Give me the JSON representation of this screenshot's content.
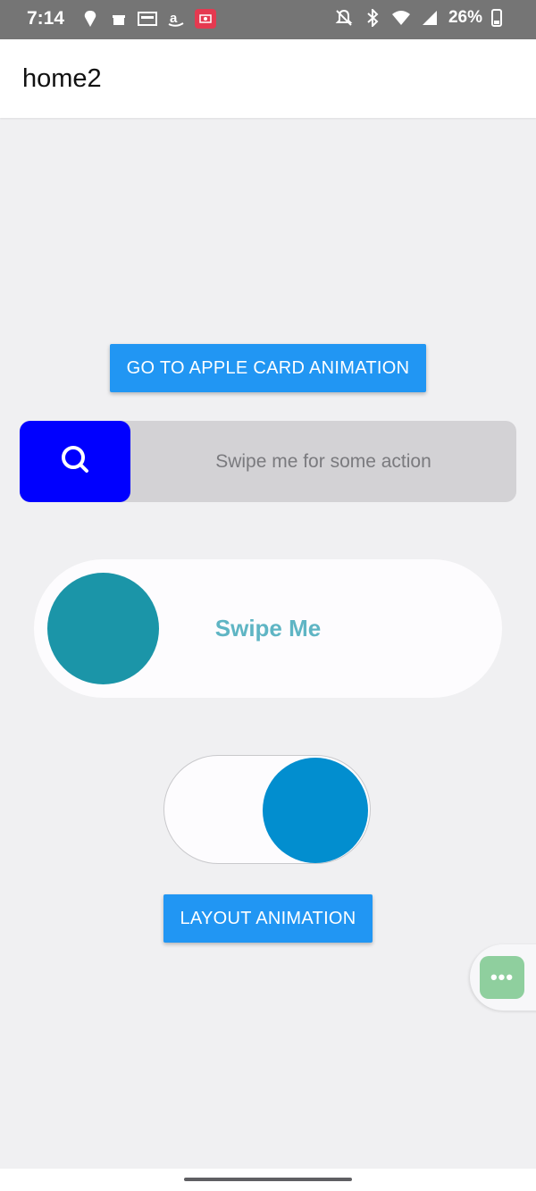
{
  "status_bar": {
    "time": "7:14",
    "battery": "26%",
    "left_icons": [
      "swiggy-icon",
      "gift-icon",
      "pay-icon",
      "amazon-icon",
      "screen-record-icon"
    ],
    "right_icons": [
      "notifications-off-icon",
      "bluetooth-icon",
      "wifi-icon",
      "signal-icon",
      "battery-icon"
    ]
  },
  "app_bar": {
    "title": "home2"
  },
  "buttons": {
    "apple_card": "GO TO APPLE CARD ANIMATION",
    "layout_animation": "LAYOUT ANIMATION"
  },
  "swipe_button_1": {
    "label": "Swipe me for some action",
    "thumb_icon": "search-icon",
    "thumb_color": "#0000ff",
    "track_color": "#d3d2d5"
  },
  "swipe_button_2": {
    "label": "Swipe Me",
    "thumb_color": "#1b95a8",
    "label_color": "#5fb5c4"
  },
  "toggle": {
    "state": "on",
    "knob_color": "#028ecf"
  },
  "floating_button": {
    "icon": "more-horizontal-icon",
    "glyph": "•••",
    "color": "#8fcf9e"
  },
  "colors": {
    "accent": "#2196f3",
    "background": "#f0f0f2"
  }
}
